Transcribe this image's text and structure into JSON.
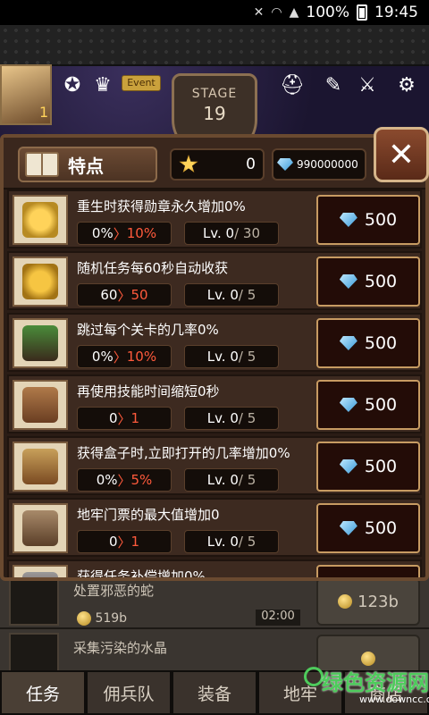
{
  "status_bar": {
    "battery": "100%",
    "time": "19:45"
  },
  "hud": {
    "level": "1",
    "event_label": "Event",
    "stage_label": "STAGE",
    "stage_number": "19"
  },
  "panel": {
    "title": "特点",
    "medals": "0",
    "gems": "990000000",
    "close_label": "✕",
    "rows": [
      {
        "icon": "medal-icon",
        "title": "重生时获得勋章永久增加0%",
        "current": "0%",
        "next": "10%",
        "lv": "Lv. 0",
        "lv_max": "/ 30",
        "cost": "500"
      },
      {
        "icon": "gold-money-icon",
        "title": "随机任务每60秒自动收获",
        "current": "60",
        "next": "50",
        "lv": "Lv. 0",
        "lv_max": "/ 5",
        "cost": "500"
      },
      {
        "icon": "floating-island-icon",
        "title": "跳过每个关卡的几率0%",
        "current": "0%",
        "next": "10%",
        "lv": "Lv. 0",
        "lv_max": "/ 5",
        "cost": "500"
      },
      {
        "icon": "hourglass-icon",
        "title": "再使用技能时间缩短0秒",
        "current": "0",
        "next": "1",
        "lv": "Lv. 0",
        "lv_max": "/ 5",
        "cost": "500"
      },
      {
        "icon": "treasure-chest-icon",
        "title": "获得盒子时,立即打开的几率增加0%",
        "current": "0%",
        "next": "5%",
        "lv": "Lv. 0",
        "lv_max": "/ 5",
        "cost": "500"
      },
      {
        "icon": "dungeon-door-icon",
        "title": "地牢门票的最大值增加0",
        "current": "0",
        "next": "1",
        "lv": "Lv. 0",
        "lv_max": "/ 5",
        "cost": "500"
      },
      {
        "icon": "spike-icon",
        "title": "获得任务补偿增加0%",
        "current": "",
        "next": "",
        "lv": "",
        "lv_max": "",
        "cost": ""
      }
    ]
  },
  "background_quests": [
    {
      "title": "处置邪恶的蛇",
      "gold": "519b",
      "time": "02:00",
      "reward": "123b"
    },
    {
      "title": "采集污染的水晶",
      "gold": "",
      "time": "",
      "reward": ""
    }
  ],
  "tabs": [
    "任务",
    "佣兵队",
    "装备",
    "地牢",
    "商店"
  ],
  "watermark": {
    "text": "绿色资源网",
    "url": "www.downcc.com"
  },
  "colors": {
    "accent_red": "#ff5a3c",
    "gem_blue": "#3a9ad8",
    "panel_bg": "#2a1c15",
    "button_border": "#c79b62"
  }
}
